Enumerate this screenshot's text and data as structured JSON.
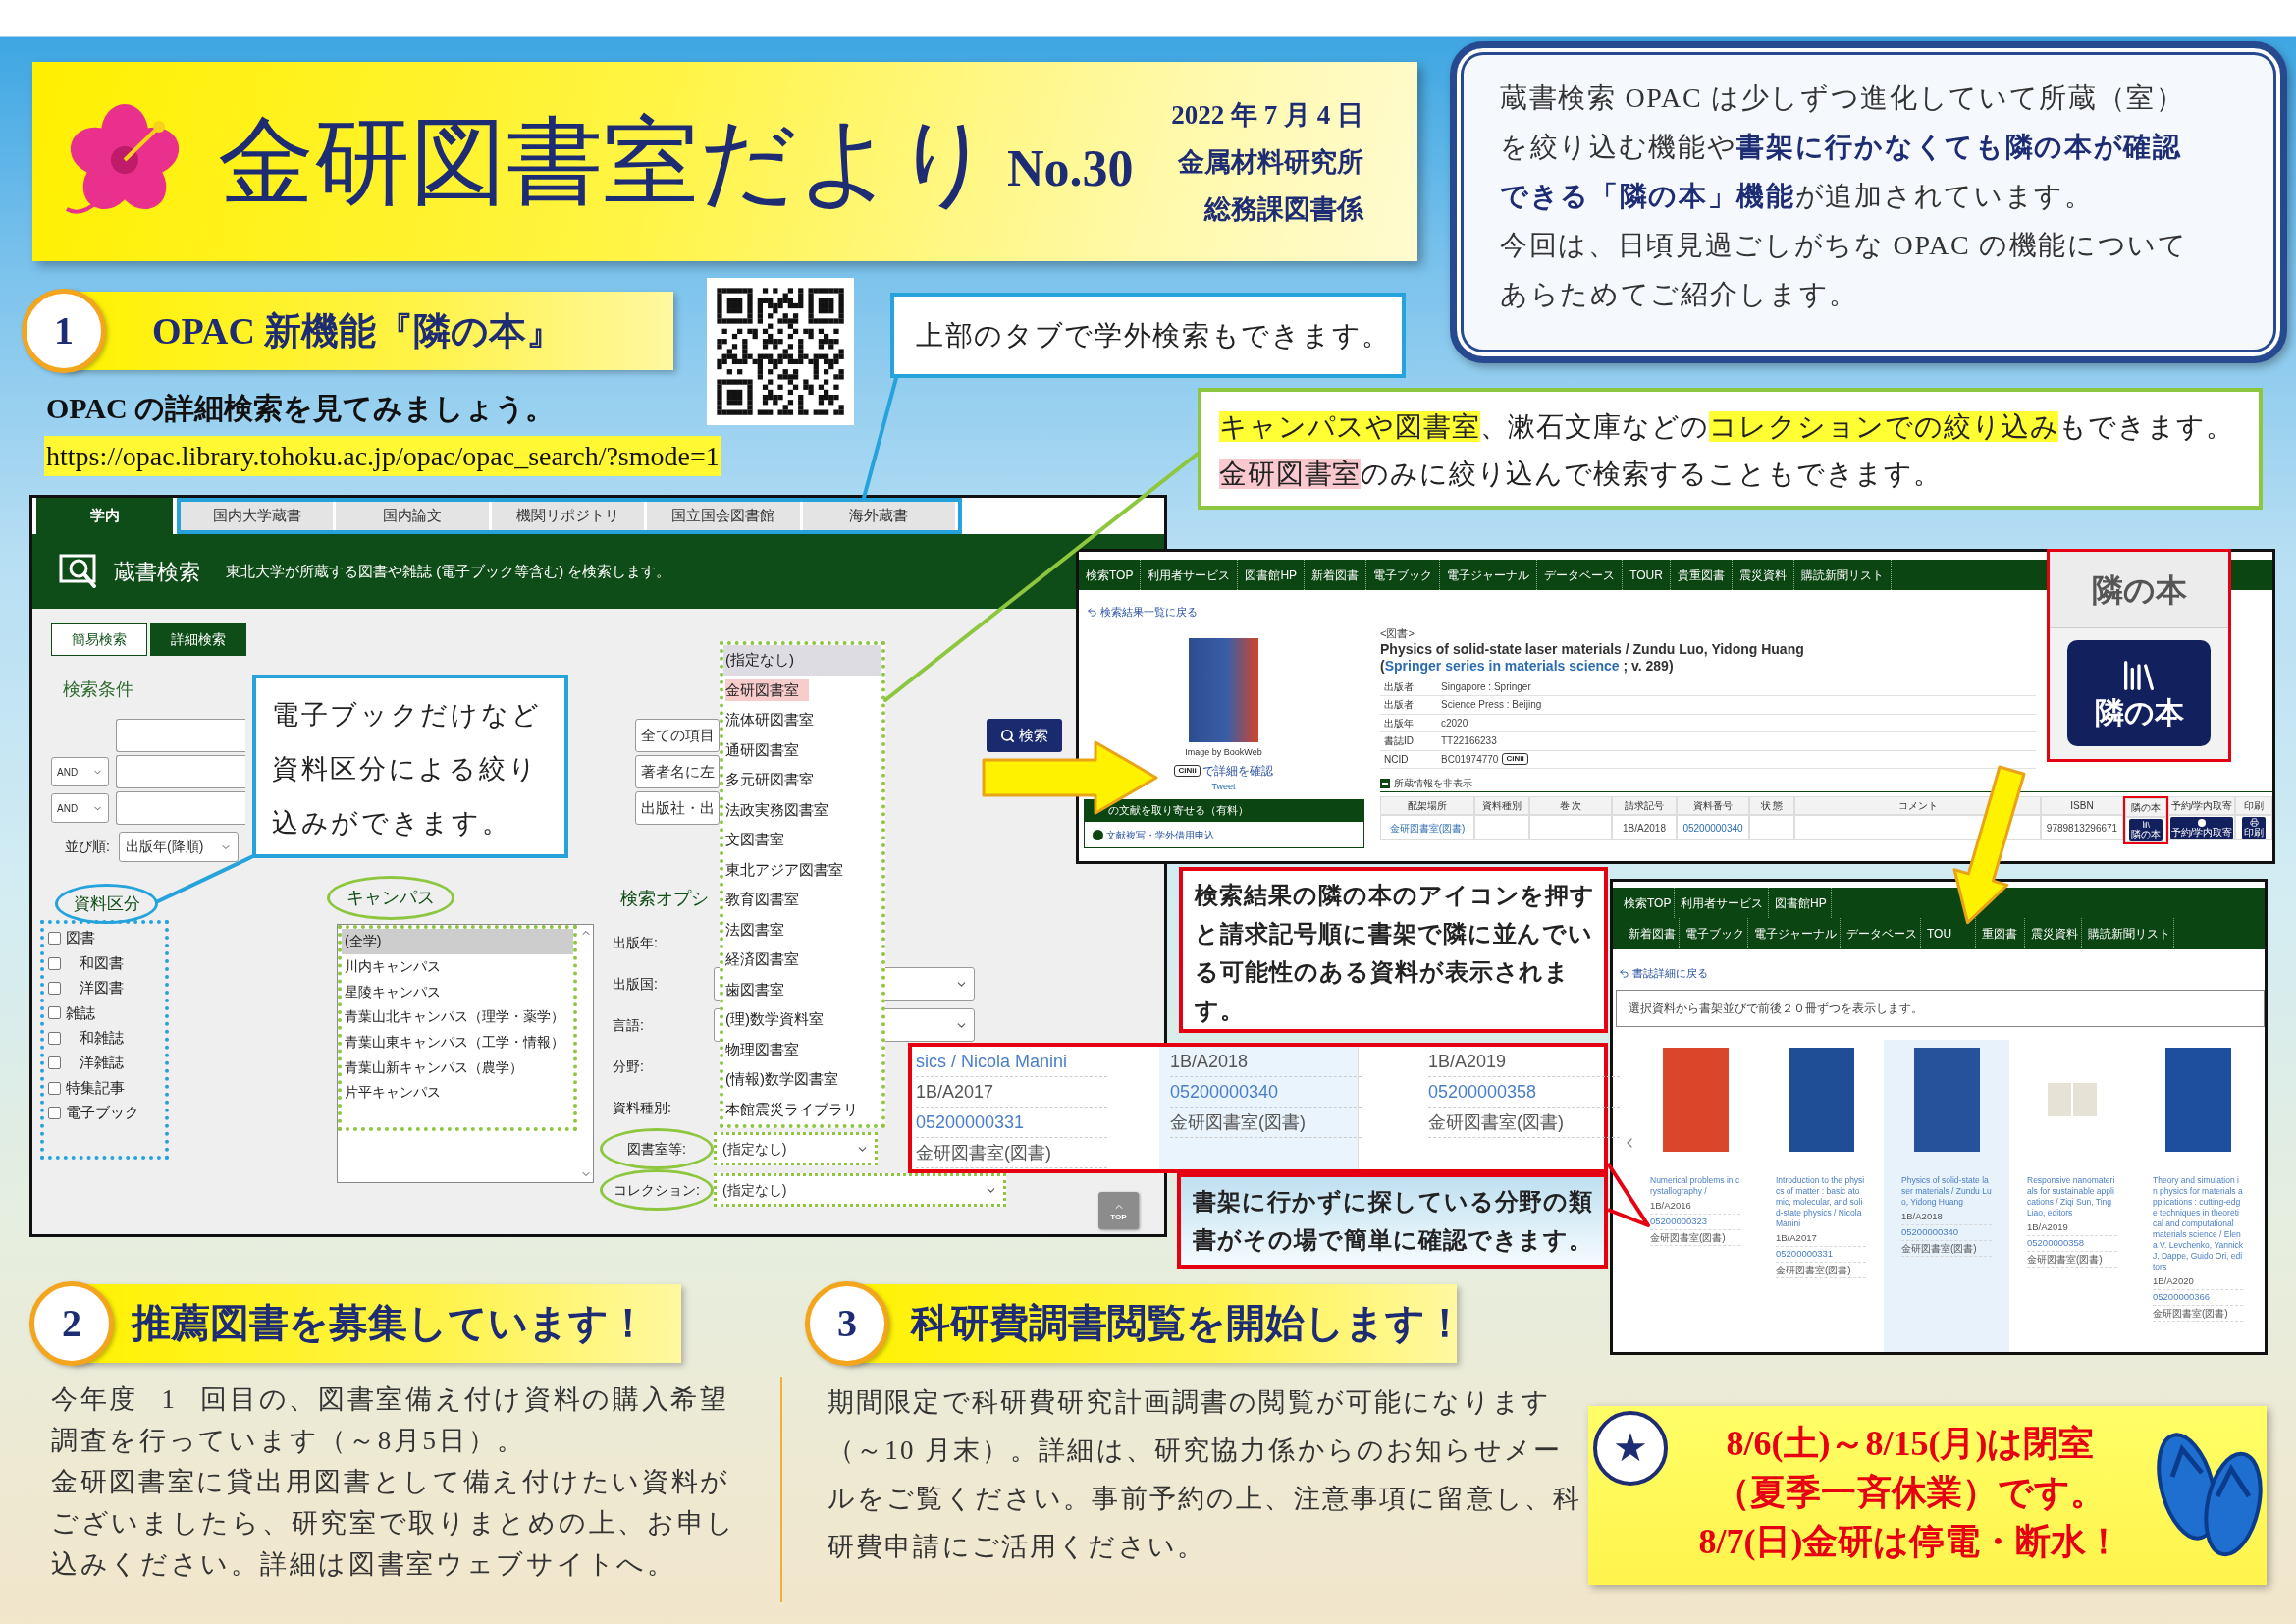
{
  "header": {
    "title": "金研図書室だより",
    "issue": "No.30",
    "date": "2022 年 7 月 4 日",
    "org_lines": [
      "金属材料研究所",
      "総務課図書係"
    ]
  },
  "intro": {
    "paragraphs": [
      "蔵書検索 OPAC は少しずつ進化していて所蔵（室）を絞り込む機能や**書架に行かなくても隣の本が確認できる「隣の本」機能**が追加されています。",
      "今回は、日頃見過ごしがちな OPAC の機能についてあらためてご紹介します。"
    ]
  },
  "section1": {
    "number": "1",
    "title": "OPAC 新機能『隣の本』",
    "lead": "OPAC の詳細検索を見てみましょう。",
    "url": "https://opac.library.tohoku.ac.jp/opac/opac_search/?smode=1"
  },
  "callouts": {
    "tabs_note": "上部のタブで学外検索もできます。",
    "filter_note": [
      [
        {
          "text": "キャンパスや図書室",
          "color": "#ffff33"
        },
        {
          "text": "、漱石文庫などの"
        },
        {
          "text": "コレクションでの絞り込み",
          "color": "#ffff33"
        },
        {
          "text": "もできます。"
        }
      ],
      [
        {
          "text": "金研図書室",
          "color": "#f9c9cf"
        },
        {
          "text": "のみに絞り込んで検索することもできます。"
        }
      ]
    ],
    "material_note": "電子ブックだけなど資料区分による絞り込みができます。",
    "neighbor_note": "検索結果の隣の本のアイコンを押すと請求記号順に書架で隣に並んでいる可能性のある資料が表示されます。",
    "shelf_note": "書架に行かずに探している分野の類書がその場で簡単に確認できます。"
  },
  "search_screen": {
    "tabs": [
      {
        "label": "学内",
        "selected": true
      },
      {
        "label": "国内大学蔵書",
        "selected": false
      },
      {
        "label": "国内論文",
        "selected": false
      },
      {
        "label": "機関リポジトリ",
        "selected": false
      },
      {
        "label": "国立国会図書館",
        "selected": false
      },
      {
        "label": "海外蔵書",
        "selected": false
      }
    ],
    "title": "蔵書検索",
    "description": "東北大学が所蔵する図書や雑誌 (電子ブック等含む) を検索します。",
    "modes": [
      {
        "label": "簡易検索",
        "selected": false
      },
      {
        "label": "詳細検索",
        "selected": true
      }
    ],
    "conditions_label": "検索条件",
    "condition_rows": [
      {
        "field": "全ての項目"
      },
      {
        "operator": "AND",
        "field": "著者名に左"
      },
      {
        "operator": "AND",
        "field": "出版社・出"
      }
    ],
    "search_button": "検索",
    "sort": {
      "label": "並び順:",
      "value": "出版年(降順)"
    },
    "material_types": {
      "label": "資料区分",
      "items": [
        {
          "label": "図書",
          "checked": false,
          "children": [
            {
              "label": "和図書",
              "checked": false
            },
            {
              "label": "洋図書",
              "checked": false
            }
          ]
        },
        {
          "label": "雑誌",
          "checked": false,
          "children": [
            {
              "label": "和雑誌",
              "checked": false
            },
            {
              "label": "洋雑誌",
              "checked": false
            }
          ]
        },
        {
          "label": "特集記事",
          "checked": false
        },
        {
          "label": "電子ブック",
          "checked": false
        }
      ]
    },
    "campus": {
      "label": "キャンパス",
      "items": [
        {
          "label": "(全学)",
          "selected": true
        },
        {
          "label": "川内キャンパス",
          "selected": false
        },
        {
          "label": "星陵キャンパス",
          "selected": false
        },
        {
          "label": "青葉山北キャンパス（理学・薬学）",
          "selected": false
        },
        {
          "label": "青葉山東キャンパス（工学・情報）",
          "selected": false
        },
        {
          "label": "青葉山新キャンパス（農学）",
          "selected": false
        },
        {
          "label": "片平キャンパス",
          "selected": false
        }
      ]
    },
    "options_label": "検索オプシ",
    "options": [
      {
        "label": "出版年:",
        "kind": "label",
        "circled": false
      },
      {
        "label": "出版国:",
        "kind": "select",
        "circled": false
      },
      {
        "label": "言語:",
        "kind": "select",
        "circled": false
      },
      {
        "label": "分野:",
        "kind": "label",
        "circled": false
      },
      {
        "label": "資料種別:",
        "kind": "label",
        "circled": false
      },
      {
        "label": "図書室等:",
        "kind": "library",
        "value": "(指定なし)",
        "circled": true
      },
      {
        "label": "コレクション:",
        "kind": "collection",
        "value": "(指定なし)",
        "circled": true
      }
    ],
    "library_dropdown": [
      {
        "label": "(指定なし)",
        "selected": true,
        "marked": false
      },
      {
        "label": "金研図書室",
        "selected": false,
        "marked": true
      },
      {
        "label": "流体研図書室",
        "selected": false,
        "marked": false
      },
      {
        "label": "通研図書室",
        "selected": false,
        "marked": false
      },
      {
        "label": "多元研図書室",
        "selected": false,
        "marked": false
      },
      {
        "label": "法政実務図書室",
        "selected": false,
        "marked": false
      },
      {
        "label": "文図書室",
        "selected": false,
        "marked": false
      },
      {
        "label": "東北アジア図書室",
        "selected": false,
        "marked": false
      },
      {
        "label": "教育図書室",
        "selected": false,
        "marked": false
      },
      {
        "label": "法図書室",
        "selected": false,
        "marked": false
      },
      {
        "label": "経済図書室",
        "selected": false,
        "marked": false
      },
      {
        "label": "歯図書室",
        "selected": false,
        "marked": false
      },
      {
        "label": "(理)数学資料室",
        "selected": false,
        "marked": false
      },
      {
        "label": "物理図書室",
        "selected": false,
        "marked": false
      },
      {
        "label": "(情報)数学図書室",
        "selected": false,
        "marked": false
      },
      {
        "label": "本館震災ライブラリ",
        "selected": false,
        "marked": false
      }
    ],
    "top_button": "TOP"
  },
  "detail_screen": {
    "nav": [
      "検索TOP",
      "利用者サービス",
      "図書館HP",
      "新着図書",
      "電子ブック",
      "電子ジャーナル",
      "データベース",
      "TOUR",
      "貴重図書",
      "震災資料",
      "購読新聞リスト"
    ],
    "back_link": "検索結果一覧に戻る",
    "cover_caption": "Image by BookWeb",
    "cinii_badge": "CiNii",
    "cinii_link": "で詳細を確認",
    "tweet": "Tweet",
    "order_title": "の文献を取り寄せる（有料）",
    "order_link": "文献複写・学外借用申込",
    "record_type": "<図書>",
    "title": "Physics of solid-state laser materials / Zundu Luo, Yidong Huang",
    "series": {
      "prefix": "(",
      "link": "Springer series in materials science",
      "suffix": " ; v. 289)"
    },
    "meta": [
      {
        "label": "出版者",
        "value": "Singapore : Springer"
      },
      {
        "label": "出版者",
        "value": "Science Press : Beijing"
      },
      {
        "label": "出版年",
        "value": "c2020"
      },
      {
        "label": "書誌ID",
        "value": "TT22166233"
      },
      {
        "label": "NCID",
        "value": "BC01974770",
        "badge": "CiNii"
      }
    ],
    "holdings_toggle": "所蔵情報を非表示",
    "holdings": [
      {
        "header": "配架場所",
        "kind": "link",
        "value": "金研図書室(図書)",
        "highlighted": false
      },
      {
        "header": "資料種別",
        "kind": "empty",
        "highlighted": false
      },
      {
        "header": "巻 次",
        "kind": "empty",
        "highlighted": false
      },
      {
        "header": "請求記号",
        "kind": "text",
        "value": "1B/A2018",
        "highlighted": false
      },
      {
        "header": "資料番号",
        "kind": "link",
        "value": "05200000340",
        "highlighted": false
      },
      {
        "header": "状 態",
        "kind": "empty",
        "highlighted": false
      },
      {
        "header": "コメント",
        "kind": "empty",
        "highlighted": false
      },
      {
        "header": "ISBN",
        "kind": "text",
        "value": "9789813296671",
        "highlighted": false
      },
      {
        "header": "隣の本",
        "kind": "neighbor_button",
        "value": "隣の本",
        "highlighted": true
      },
      {
        "header": "予約/学内取寄",
        "kind": "reserve_button",
        "value": "予約/学内取寄",
        "highlighted": false
      },
      {
        "header": "印刷",
        "kind": "print_button",
        "value": "印刷",
        "highlighted": false
      }
    ]
  },
  "neighbor_zoom": {
    "label": "隣の本",
    "button": "隣の本"
  },
  "shelf_screen": {
    "nav_rows": [
      [
        "検索TOP",
        "利用者サービス",
        "図書館HP"
      ],
      [
        "新着図書",
        "電子ブック",
        "電子ジャーナル",
        "データベース",
        "TOU",
        "重図書",
        "震災資料",
        "購読新聞リスト"
      ]
    ],
    "back_link": "書誌詳細に戻る",
    "notice": "選択資料から書架並びで前後２０冊ずつを表示します。",
    "books": [
      {
        "title": "Numerical problems in crystallography /",
        "call_number": "1B/A2016",
        "item_id": "05200000323",
        "location": "金研図書室(図書)",
        "selected": false,
        "kind": "cover",
        "color": "#d9462a"
      },
      {
        "title": "Introduction to the physics of matter : basic atomic, molecular, and solid-state physics / Nicola Manini",
        "call_number": "1B/A2017",
        "item_id": "05200000331",
        "location": "金研図書室(図書)",
        "selected": false,
        "kind": "cover",
        "color": "#1f4e96"
      },
      {
        "title": "Physics of solid-state laser materials / Zundu Luo, Yidong Huang",
        "call_number": "1B/A2018",
        "item_id": "05200000340",
        "location": "金研図書室(図書)",
        "selected": true,
        "kind": "cover",
        "color": "#25529b"
      },
      {
        "title": "Responsive nanomaterials for sustainable applications / Ziqi Sun, Ting Liao, editors",
        "call_number": "1B/A2019",
        "item_id": "05200000358",
        "location": "金研図書室(図書)",
        "selected": false,
        "kind": "placeholder"
      },
      {
        "title": "Theory and simulation in physics for materials applications : cutting-edge techniques in theoretical and computational materials science / Elena V. Levchenko, Yannick J. Dappe, Guido Ori, editors",
        "call_number": "1B/A2020",
        "item_id": "05200000366",
        "location": "金研図書室(図書)",
        "selected": false,
        "kind": "cover",
        "color": "#1c4f9e"
      }
    ]
  },
  "shelf_zoom": {
    "columns": [
      {
        "selected": false,
        "title_tail": "sics / Nicola Manini",
        "call_number": "1B/A2017",
        "item_id": "05200000331",
        "location": "金研図書室(図書)"
      },
      {
        "selected": true,
        "call_number": "1B/A2018",
        "item_id": "05200000340",
        "location": "金研図書室(図書)"
      },
      {
        "selected": false,
        "call_number": "1B/A2019",
        "item_id": "05200000358",
        "location": "金研図書室(図書)"
      }
    ]
  },
  "section2": {
    "number": "2",
    "title": "推薦図書を募集しています！",
    "paragraphs": [
      "今年度 1 回目の、図書室備え付け資料の購入希望調査を行っています（～8月5日）。",
      "金研図書室に貸出用図書として備え付けたい資料がございましたら、研究室で取りまとめの上、お申し込みください。詳細は図書室ウェブサイトへ。"
    ]
  },
  "section3": {
    "number": "3",
    "title": "科研費調書閲覧を開始します！",
    "paragraphs": [
      "期間限定で科研費研究計画調書の閲覧が可能になります（～10 月末）。詳細は、研究協力係からのお知らせメールをご覧ください。事前予約の上、注意事項に留意し、科研費申請にご活用ください。"
    ]
  },
  "closure": {
    "mark": "★",
    "lines": [
      "8/6(土)～8/15(月)は閉室",
      "（夏季一斉休業）です。",
      "8/7(日)金研は停電・断水！"
    ]
  }
}
